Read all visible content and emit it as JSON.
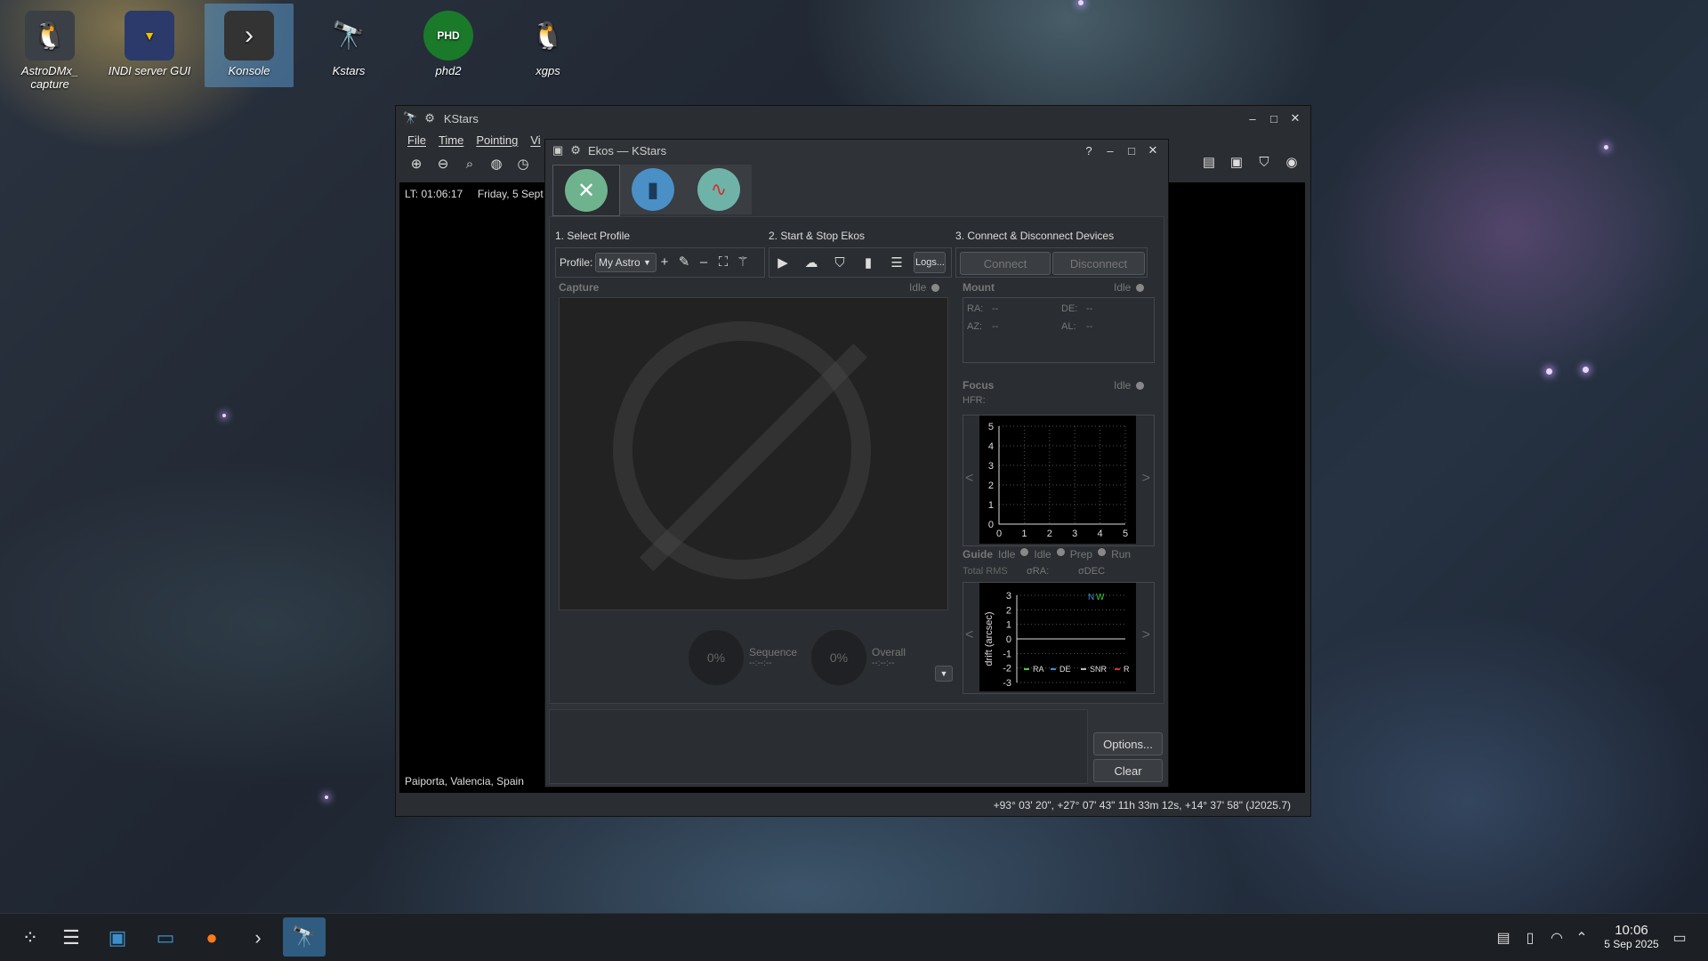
{
  "desktop": {
    "icons": [
      {
        "label": "AstroDMx_ capture",
        "icon": "penguin-telescope-icon"
      },
      {
        "label": "INDI server GUI",
        "icon": "indi-icon"
      },
      {
        "label": "Konsole",
        "icon": "terminal-icon"
      },
      {
        "label": "Kstars",
        "icon": "telescope-icon"
      },
      {
        "label": "phd2",
        "icon": "phd-icon",
        "badge": "PHD"
      },
      {
        "label": "xgps",
        "icon": "penguin-icon"
      }
    ]
  },
  "kstars": {
    "title": "KStars",
    "menu": [
      "File",
      "Time",
      "Pointing",
      "Vi"
    ],
    "info_time": "LT: 01:06:17",
    "info_date": "Friday, 5 Sept",
    "location": "Paiporta, Valencia, Spain",
    "coords": "+93° 03' 20\", +27° 07' 43\"  11h 33m 12s, +14° 37' 58\" (J2025.7)"
  },
  "ekos": {
    "title": "Ekos — KStars",
    "step1": "1. Select Profile",
    "step2": "2. Start & Stop Ekos",
    "step3": "3. Connect & Disconnect Devices",
    "profile_label": "Profile:",
    "profile_value": "My Astro",
    "logs_label": "Logs...",
    "connect_label": "Connect",
    "disconnect_label": "Disconnect",
    "capture": {
      "title": "Capture",
      "status": "Idle"
    },
    "sequence": {
      "percent": "0%",
      "label": "Sequence",
      "time": "--:--:--"
    },
    "overall": {
      "percent": "0%",
      "label": "Overall",
      "time": "--:--:--"
    },
    "mount": {
      "title": "Mount",
      "status": "Idle",
      "ra_label": "RA:",
      "ra_value": "--",
      "de_label": "DE:",
      "de_value": "--",
      "az_label": "AZ:",
      "az_value": "--",
      "al_label": "AL:",
      "al_value": "--"
    },
    "focus": {
      "title": "Focus",
      "status": "Idle",
      "hfr_label": "HFR:",
      "y_ticks": [
        "5",
        "4",
        "3",
        "2",
        "1",
        "0"
      ],
      "x_ticks": [
        "0",
        "1",
        "2",
        "3",
        "4",
        "5"
      ]
    },
    "guide": {
      "title": "Guide",
      "states": [
        "Idle",
        "Idle",
        "Prep",
        "Run"
      ],
      "total_label": "Total RMS",
      "ra_label": "σRA:",
      "dec_label": "σDEC",
      "y_ticks": [
        "3",
        "2",
        "1",
        "0",
        "-1",
        "-2",
        "-3"
      ],
      "ylabel": "drift (arcsec)",
      "compass_n": "N",
      "compass_w": "W",
      "legend": [
        "RA",
        "DE",
        "SNR",
        "R"
      ]
    },
    "options_label": "Options...",
    "clear_label": "Clear"
  },
  "taskbar": {
    "time": "10:06",
    "date": "5 Sep 2025"
  },
  "colors": {
    "accent": "#3d8fcc",
    "window_bg": "#2a2d31",
    "taskbar_bg": "#1c1f23"
  }
}
